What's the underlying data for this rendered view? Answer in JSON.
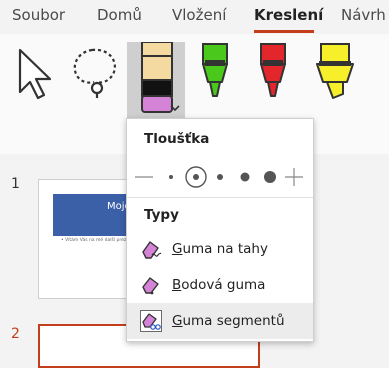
{
  "tabs": [
    {
      "label": "Soubor"
    },
    {
      "label": "Domů"
    },
    {
      "label": "Vložení"
    },
    {
      "label": "Kreslení",
      "active": true
    },
    {
      "label": "Návrh"
    }
  ],
  "colors": {
    "accent": "#c43e1c",
    "pen_green": "#4ac81c",
    "pen_red": "#e3262b",
    "highlighter_yellow": "#f7ef2a",
    "eraser_pink": "#d583d6"
  },
  "ribbon": {
    "tools": [
      {
        "icon": "select-arrow-icon"
      },
      {
        "icon": "lasso-select-icon"
      },
      {
        "icon": "eraser-icon",
        "selected": true
      },
      {
        "icon": "green-pen-icon"
      },
      {
        "icon": "red-pen-icon"
      },
      {
        "icon": "yellow-highlighter-icon"
      }
    ]
  },
  "menu": {
    "thickness_title": "Tloušťka",
    "types_title": "Typy",
    "items": [
      {
        "label": "Guma na tahy",
        "icon": "stroke-eraser-icon"
      },
      {
        "label": "Bodová guma",
        "icon": "point-eraser-icon"
      },
      {
        "label": "Guma segmentů",
        "icon": "segment-eraser-icon",
        "highlighted": true
      }
    ]
  },
  "slides": [
    {
      "number": "1",
      "title_fragment": "Moje",
      "body_fragment": "• Vítám Vás na mé další prezentaci"
    },
    {
      "number": "2"
    }
  ]
}
